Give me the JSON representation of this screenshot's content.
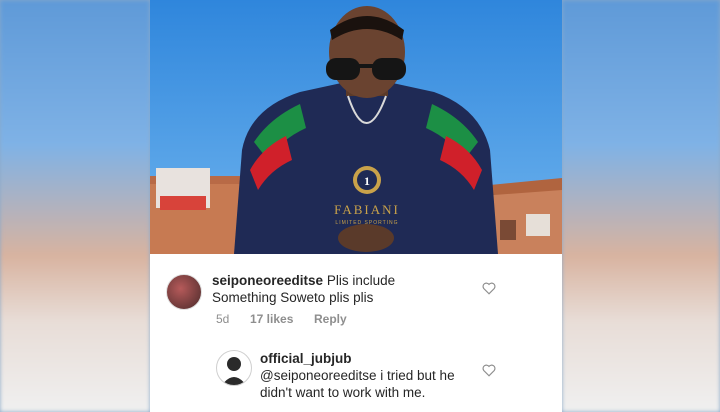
{
  "comments": [
    {
      "username": "seiponeoreeditse",
      "text_line1": "Plis include",
      "text_line2": "Something Soweto plis plis",
      "time": "5d",
      "likes": "17 likes",
      "reply": "Reply"
    },
    {
      "username": "official_jubjub",
      "text_line1": "@seiponeoreeditse i tried  but he",
      "text_line2": "didn't want to work with me."
    }
  ],
  "photo": {
    "sweater_text": "FABIANI",
    "sweater_subtext": "LIMITED SPORTING",
    "badge_text": "1"
  },
  "colors": {
    "sky": "#3c8fe0",
    "sweater": "#1f2a55",
    "stripe_green": "#1c8f45",
    "stripe_red": "#d0202a",
    "wall": "#c8784f"
  }
}
